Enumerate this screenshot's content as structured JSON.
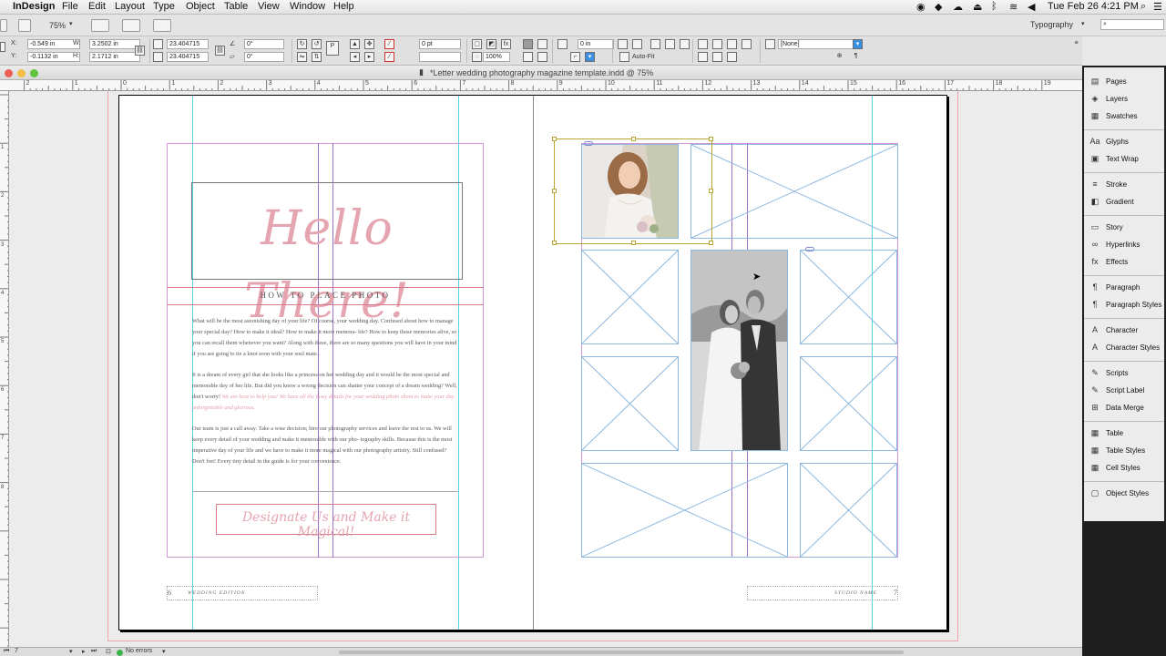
{
  "menubar": {
    "app": "InDesign",
    "items": [
      "File",
      "Edit",
      "Layout",
      "Type",
      "Object",
      "Table",
      "View",
      "Window",
      "Help"
    ],
    "clock": "Tue Feb 26  4:21 PM"
  },
  "appbar": {
    "zoom": "75%",
    "workspace": "Typography"
  },
  "control": {
    "x": "-0.549 in",
    "y": "-0.1132 in",
    "w": "3.2502 in",
    "h": "2.1712 in",
    "scale_x": "23.404715",
    "scale_y": "23.404715",
    "rotate": "0°",
    "shear": "0°",
    "stroke_weight": "0 pt",
    "offset": "0 in",
    "opacity": "100%",
    "auto_fit": "Auto-Fit",
    "object_style": "[None]"
  },
  "document": {
    "title": "*Letter wedding photography magazine template.indd @ 75%",
    "ruler_numbers": [
      "2",
      "1",
      "0",
      "1",
      "2",
      "3",
      "4",
      "5",
      "6",
      "7",
      "8",
      "9",
      "10",
      "11",
      "12",
      "13",
      "14",
      "15",
      "16",
      "17",
      "18",
      "19"
    ],
    "vruler_numbers": [
      "1",
      "2",
      "3",
      "4",
      "5",
      "6",
      "7",
      "8"
    ]
  },
  "left_page": {
    "headline": "Hello There!",
    "subheading": "HOW TO PLACE PHOTO",
    "paragraph1": "What will be the most astonishing day of your life? Of course, your wedding day. Confused about how to manage your special day? How to make it ideal? How to make it more memora- ble? How to keep those memories alive, so you can recall them whenever you want? Along with these, there are so many questions you will have in your mind if you are going to tie a knot soon with your soul mate.",
    "paragraph2": "It is a dream of every girl that she looks like a princess on her wedding day and it would be the most special and memorable day of her life. But did you know a wrong decision can shatter your concept of a dream wedding? Well, don't worry!",
    "paragraph2_pink": "We are here to help you! We have all the fussy details for your wedding photo shoot to make your day unforgettable and glorious.",
    "paragraph3": "Our team is just a call away. Take a wise decision; hire our photography services and leave the rest to us. We will keep every detail of your wedding and make it memorable with our pho- tography skills. Because this is the most imperative day of your life and we have to make it more magical with our photography artistry. Still confused? Don't fret! Every tiny detail in the guide is for your convenience.",
    "tagline": "Designate Us and Make it Magical!",
    "folio_number": "6",
    "folio_label": "WEDDING EDITION"
  },
  "right_page": {
    "folio_number": "7",
    "folio_label": "STUDIO NAME"
  },
  "panel": {
    "items": [
      {
        "label": "Pages",
        "icon": "▤"
      },
      {
        "label": "Layers",
        "icon": "◈"
      },
      {
        "label": "Swatches",
        "icon": "▦"
      },
      {
        "label": "Glyphs",
        "icon": "Aa"
      },
      {
        "label": "Text Wrap",
        "icon": "▣"
      },
      {
        "label": "Stroke",
        "icon": "≡"
      },
      {
        "label": "Gradient",
        "icon": "◧"
      },
      {
        "label": "Story",
        "icon": "▭"
      },
      {
        "label": "Hyperlinks",
        "icon": "∞"
      },
      {
        "label": "Effects",
        "icon": "fx"
      },
      {
        "label": "Paragraph",
        "icon": "¶"
      },
      {
        "label": "Paragraph Styles",
        "icon": "¶"
      },
      {
        "label": "Character",
        "icon": "A"
      },
      {
        "label": "Character Styles",
        "icon": "A"
      },
      {
        "label": "Scripts",
        "icon": "✎"
      },
      {
        "label": "Script Label",
        "icon": "✎"
      },
      {
        "label": "Data Merge",
        "icon": "⊞"
      },
      {
        "label": "Table",
        "icon": "▦"
      },
      {
        "label": "Table Styles",
        "icon": "▦"
      },
      {
        "label": "Cell Styles",
        "icon": "▦"
      },
      {
        "label": "Object Styles",
        "icon": "▢"
      }
    ]
  },
  "status": {
    "page": "7",
    "errors": "No errors"
  },
  "colors": {
    "margin_guide": "#d19ad6",
    "column_guide": "#55d5e3",
    "placeholder": "#8fb8e0",
    "selection": "#b7a631",
    "script_pink": "#e5a5b0"
  }
}
